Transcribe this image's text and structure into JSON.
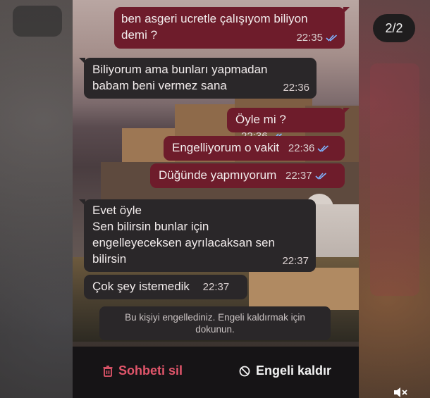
{
  "counter": "2/2",
  "messages": [
    {
      "direction": "out",
      "text": "ben asgeri ucretle çalışıyom biliyon demi ?",
      "time": "22:35",
      "read": true
    },
    {
      "direction": "in",
      "text": "Biliyorum ama bunları yapmadan babam beni vermez sana",
      "time": "22:36"
    },
    {
      "direction": "out",
      "text": "Öyle mi ?",
      "time": "22:36",
      "read": true
    },
    {
      "direction": "out",
      "text": "Engelliyorum o vakit",
      "time": "22:36",
      "read": true
    },
    {
      "direction": "out",
      "text": "Düğünde yapmıyorum",
      "time": "22:37",
      "read": true
    },
    {
      "direction": "in",
      "text": "Evet öyle\nSen bilirsin bunlar için engelleyeceksen ayrılacaksan sen bilirsin",
      "time": "22:37"
    },
    {
      "direction": "in",
      "text": "Çok şey istemedik",
      "time": "22:37"
    }
  ],
  "message_lines": {
    "m0": [
      "ben asgeri ucretle çalışıyom biliyon",
      "demi ?"
    ],
    "m1": [
      "Biliyorum ama bunları yapmadan",
      "babam beni vermez sana"
    ],
    "m5": [
      "Evet öyle",
      "Sen bilirsin bunlar için",
      "engelleyeceksen ayrılacaksan sen",
      "bilirsin"
    ]
  },
  "system_note": "Bu kişiyi engellediniz. Engeli kaldırmak için dokunun.",
  "actions": {
    "delete_label": "Sohbeti sil",
    "unblock_label": "Engeli kaldır"
  },
  "icons": {
    "read_receipt": "double-check-icon",
    "delete": "trash-icon",
    "unblock": "block-icon",
    "mute": "speaker-muted-icon"
  },
  "colors": {
    "outgoing_bubble": "#6e1c2b",
    "incoming_bubble": "#2a2729",
    "read_check": "#7fb4ff",
    "delete_action": "#e2566b"
  }
}
